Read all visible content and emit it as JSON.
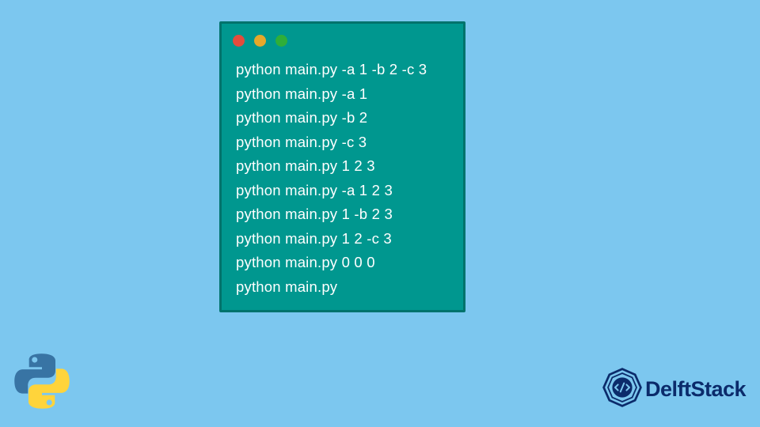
{
  "terminal": {
    "lines": [
      "python main.py -a 1 -b 2 -c 3",
      "python main.py -a 1",
      "python main.py -b 2",
      "python main.py -c 3",
      "python main.py 1 2 3",
      "python main.py -a 1 2 3",
      "python main.py 1 -b 2 3",
      "python main.py 1 2 -c 3",
      "python main.py 0 0 0",
      "python main.py"
    ]
  },
  "brand": {
    "name": "DelftStack"
  },
  "colors": {
    "background": "#7cc7ef",
    "terminal_bg": "#00978f",
    "terminal_border": "#00736c",
    "text": "#ffffff",
    "brand_text": "#0b2b6b"
  }
}
